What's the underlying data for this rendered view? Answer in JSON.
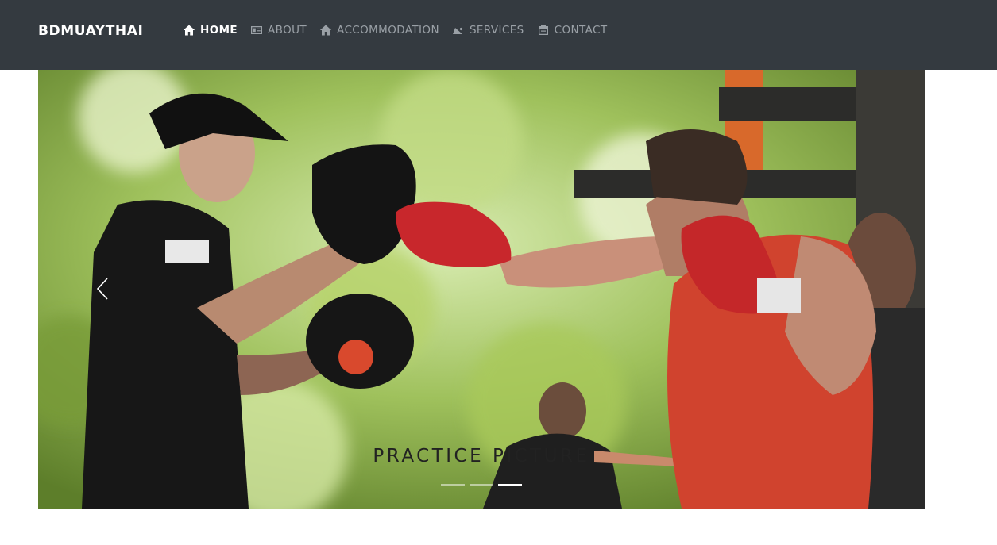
{
  "brand": "BDMUAYTHAI",
  "nav": {
    "items": [
      {
        "label": "HOME",
        "icon": "home-icon",
        "active": true
      },
      {
        "label": "ABOUT",
        "icon": "id-card-icon",
        "active": false
      },
      {
        "label": "ACCOMMODATION",
        "icon": "home-icon",
        "active": false
      },
      {
        "label": "SERVICES",
        "icon": "bed-icon",
        "active": false
      },
      {
        "label": "CONTACT",
        "icon": "envelope-icon",
        "active": false
      }
    ]
  },
  "carousel": {
    "caption": "PRACTICE PICTURE",
    "prev_icon": "chevron-left-icon",
    "slide_count": 3,
    "active_index": 2
  },
  "colors": {
    "navbar_bg": "#343a40",
    "nav_text": "#9aa0a6",
    "nav_active": "#ffffff"
  }
}
